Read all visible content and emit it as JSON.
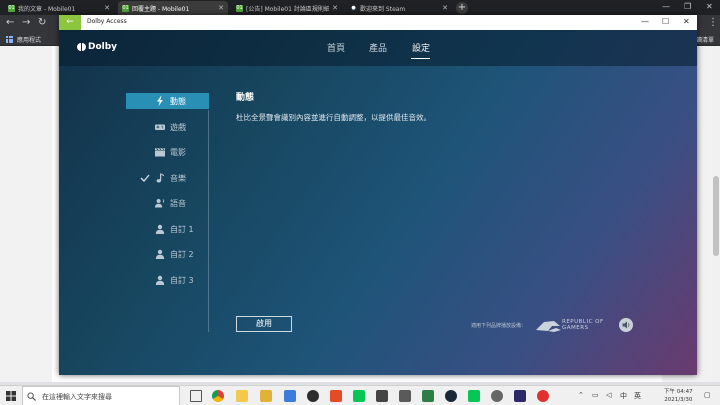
{
  "browser": {
    "tabs": [
      {
        "title": "我的文章 - Mobile01",
        "favicon": "mobile01-favicon"
      },
      {
        "title": "回覆主題 - Mobile01",
        "favicon": "mobile01-favicon"
      },
      {
        "title": "[公告] Mobile01 討論區規則細則",
        "favicon": "mobile01-favicon"
      },
      {
        "title": "歡迎來到 Steam",
        "favicon": "steam-favicon"
      }
    ],
    "new_tab": "+",
    "bookmarks_label": "應用程式",
    "reading_list": "閱讀清單"
  },
  "app": {
    "window_title": "Dolby Access",
    "back_glyph": "←",
    "logo_text": "Dolby",
    "nav": [
      {
        "label": "首頁",
        "active": false
      },
      {
        "label": "產品",
        "active": false
      },
      {
        "label": "設定",
        "active": true
      }
    ],
    "sidebar": [
      {
        "label": "動態",
        "icon": "lightning-icon",
        "active": true
      },
      {
        "label": "遊戲",
        "icon": "gamepad-icon",
        "active": false
      },
      {
        "label": "電影",
        "icon": "clapperboard-icon",
        "active": false
      },
      {
        "label": "音樂",
        "icon": "music-note-icon",
        "active": false,
        "checked": true
      },
      {
        "label": "語音",
        "icon": "voice-icon",
        "active": false
      },
      {
        "label": "自訂 1",
        "icon": "person-icon",
        "active": false
      },
      {
        "label": "自訂 2",
        "icon": "person-icon",
        "active": false
      },
      {
        "label": "自訂 3",
        "icon": "person-icon",
        "active": false
      }
    ],
    "content": {
      "title": "動態",
      "description": "杜比全景聲會識別內容並進行自動調整，以提供最佳音效。"
    },
    "enable_button": "啟用",
    "footer_note": "適用下列品牌播放設備：",
    "rog_text": [
      "REPUBLIC OF",
      "GAMERS"
    ]
  },
  "taskbar": {
    "search_placeholder": "在這裡輸入文字來搜尋",
    "time": "下午 04:47",
    "date": "2021/3/30",
    "ime_char": "中",
    "ime_char2": "英"
  },
  "colors": {
    "accent": "#2a8fb5",
    "back_button": "#8cc63f",
    "window_gradient_start": "#123148",
    "window_gradient_end": "#6a3a6e"
  }
}
